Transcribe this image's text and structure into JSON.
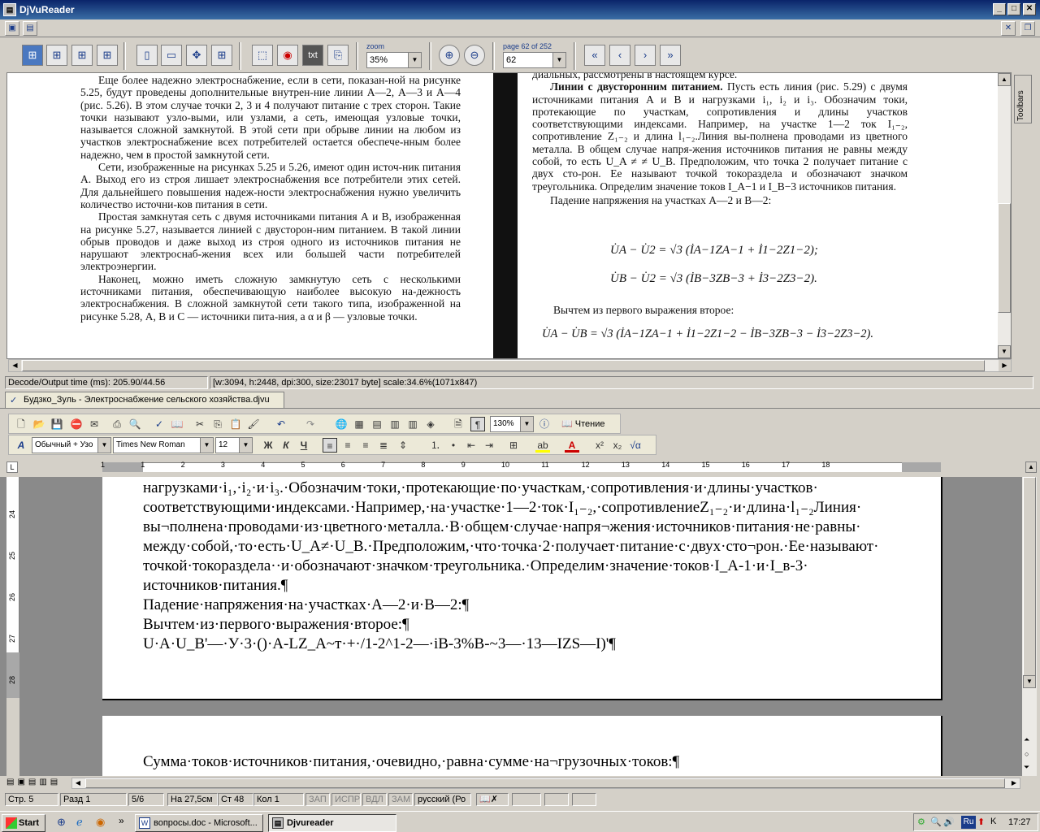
{
  "app": {
    "title": "DjVuReader"
  },
  "djvu_toolbar": {
    "zoom_label": "zoom",
    "zoom_value": "35%",
    "page_label": "page 62 of 252",
    "page_value": "62",
    "txt_label": "txt"
  },
  "toolbars_tab": "Toolbars",
  "djvu_page": {
    "left_column": [
      "Еще более надежно электроснабжение, если в сети, показан-ной на рисунке 5.25, будут проведены дополнительные внутрен-ние линии А—2, А—3 и А—4 (рис. 5.26). В этом случае точки 2, 3 и 4 получают питание с трех сторон. Такие точки называют узло-выми, или узлами, а сеть, имеющая узловые точки, называется сложной замкнутой. В этой сети при обрыве линии на любом из участков электроснабжение всех потребителей остается обеспече-нным более надежно, чем в простой замкнутой сети.",
      "Сети, изображенные на рисунках 5.25 и 5.26, имеют один источ-ник питания А. Выход его из строя лишает электроснабжения все потребители этих сетей. Для дальнейшего повышения надеж-ности электроснабжения нужно увеличить количество источни-ков питания в сети.",
      "Простая замкнутая сеть с двумя источниками питания А и В, изображенная на рисунке 5.27, называется линией с двусторон-ним питанием. В такой линии обрыв проводов и даже выход из строя одного из источников питания не нарушают электроснаб-жения всех или большей части потребителей электроэнергии.",
      "Наконец, можно иметь сложную замкнутую сеть с несколькими источниками питания, обеспечивающую наиболее высокую на-дежность электроснабжения. В сложной замкнутой сети такого типа, изображенной на рисунке 5.28, А, В и С — источники пита-ния, а α и β — узловые точки."
    ],
    "right_top": "диальных, рассмотрены в настоящем курсе.",
    "right_heading": "Линии с двусторонним питанием.",
    "right_para": "Пусть есть линия (рис. 5.29) с двумя источниками питания A и B и нагрузками i₁, i₂ и i₃. Обозначим токи, протекающие по участкам, сопротивления и длины участков соответствующими индексами. Например, на участке 1—2 ток I₁₋₂, сопротивление Z₁₋₂ и длина l₁₋₂.Линия вы-полнена проводами из цветного металла. В общем случае напря-жения источников питания не равны между собой, то есть U_A ≠ ≠ U_B. Предположим, что точка 2 получает питание с двух сто-рон. Ее называют точкой токораздела и обозначают значком треугольника. Определим значение токов I_A−1 и I_B−3 источников питания.",
    "right_drop": "Падение напряжения на участках A—2 и B—2:",
    "formula1": "U̇A − U̇2 = √3 (İA−1ZA−1 + İ1−2Z1−2);",
    "formula2": "U̇B − U̇2 = √3 (İB−3ZB−3 + İ3−2Z3−2).",
    "right_subtract": "Вычтем из первого выражения второе:",
    "formula3": "U̇A − U̇B = √3 (İA−1ZA−1 + İ1−2Z1−2 − İB−3ZB−3 − İ3−2Z3−2)."
  },
  "djvu_status": {
    "decode": "Decode/Output time (ms): 205.90/44.56",
    "info": "[w:3094, h:2448, dpi:300, size:23017 byte] scale:34.6%(1071x847)"
  },
  "djvu_doc_tab": "Будзко_Зуль - Электроснабжение сельского хозяйства.djvu",
  "word_toolbar": {
    "zoom": "130%",
    "reading": "Чтение",
    "style": "Обычный + Узо",
    "font": "Times New Roman",
    "size": "12"
  },
  "word_doc": {
    "lines": [
      "нагрузками·i₁,·i₂·и·i₃.·Обозначим·токи,·протекающие·по·участкам,·сопротивления·и·длины·участков·",
      "соответствующими·индексами.·Например,·на·участке·1—2·ток·I₁₋₂,·сопротивлениеZ₁₋₂·и·длина·l₁₋₂Линия·",
      "вы¬полнена·проводами·из·цветного·металла.·В·общем·случае·напря¬жения·источников·питания·не·равны·",
      "между·собой,·то·есть·U_A≠·U_B.·Предположим,·что·точка·2·получает·питание·с·двух·сто¬рон.·Ее·называют·",
      "точкой·токораздела··и·обозначают·значком·треугольника.·Определим·значение·токов·I_A-1·и·I_в-3·",
      "источников·питания.¶",
      "Падение·напряжения·на·участках·А—2·и·В—2:¶",
      "Вычтем·из·первого·выражения·второе:¶",
      "U·A·U_B'—·У·3·()·A-LZ_A~т·+·/1-2^1-2—·iB-3%B-~3—·13—IZS—I)'¶"
    ],
    "page2_line": "Сумма·токов·источников·питания,·очевидно,·равна·сумме·на¬грузочных·токов:¶"
  },
  "ruler_numbers": [
    "1",
    "1",
    "2",
    "3",
    "4",
    "5",
    "6",
    "7",
    "8",
    "9",
    "10",
    "11",
    "12",
    "13",
    "14",
    "15",
    "16",
    "17",
    "18"
  ],
  "vruler_numbers": [
    "24",
    "25",
    "26",
    "27",
    "28"
  ],
  "word_status": {
    "page": "Стр.  5",
    "section": "Разд  1",
    "pages": "5/6",
    "at": "На 27,5см",
    "line": "Ст  48",
    "col": "Кол  1",
    "rec": "ЗАП",
    "trk": "ИСПР",
    "ext": "ВДЛ",
    "ovr": "ЗАМ",
    "lang": "русский (Ро"
  },
  "taskbar": {
    "start": "Start",
    "tasks": [
      "вопросы.doc - Microsoft...",
      "Djvureader"
    ],
    "lang": "Ru",
    "clock": "17:27"
  }
}
